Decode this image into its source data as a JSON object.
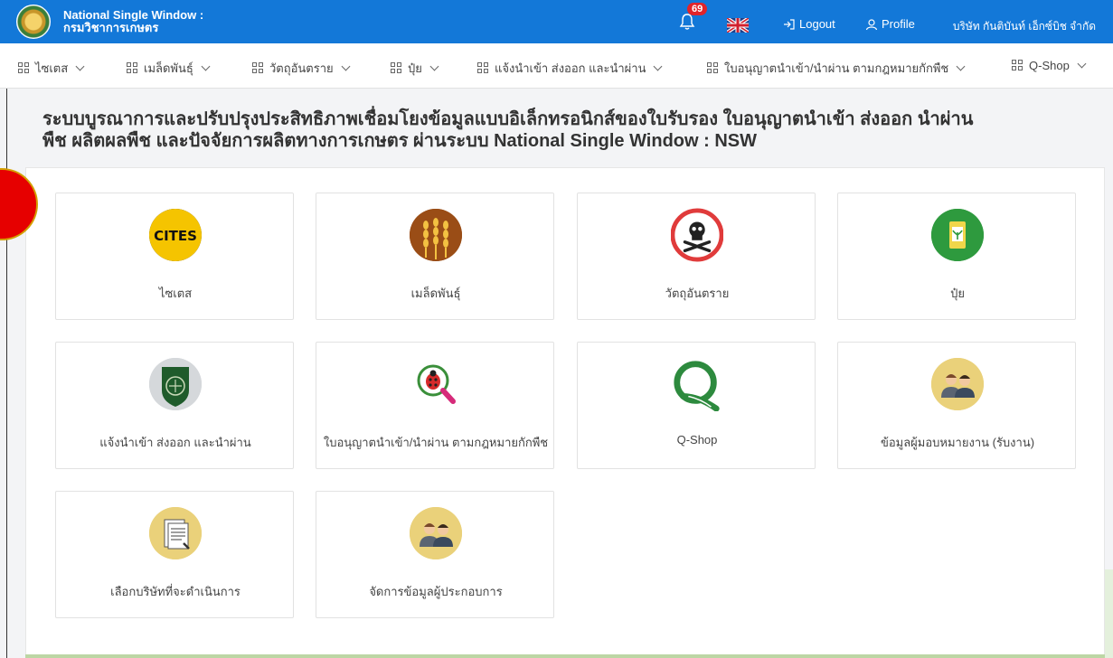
{
  "header": {
    "brand_title": "National Single Window :",
    "brand_subtitle": "กรมวิชาการเกษตร",
    "notification_count": "69",
    "logout_label": "Logout",
    "profile_label": "Profile",
    "company_name": "บริษัท กันติบันท์ เอ็กซ์บิช จำกัด",
    "color": "#1378d8"
  },
  "nav": {
    "items": [
      {
        "label": "ไซเตส"
      },
      {
        "label": "เมล็ดพันธุ์"
      },
      {
        "label": "วัตถุอันตราย"
      },
      {
        "label": "ปุ๋ย"
      },
      {
        "label": "แจ้งนำเข้า ส่งออก และนำผ่าน"
      },
      {
        "label": "ใบอนุญาตนำเข้า/นำผ่าน ตามกฎหมายกักพืช"
      },
      {
        "label": "Q-Shop"
      }
    ]
  },
  "page": {
    "heading_line1": "ระบบบูรณาการและปรับปรุงประสิทธิภาพเชื่อมโยงข้อมูลแบบอิเล็กทรอนิกส์ของใบรับรอง ใบอนุญาตนำเข้า ส่งออก นำผ่าน",
    "heading_line2": "พืช ผลิตผลพืช และปัจจัยการผลิตทางการเกษตร ผ่านระบบ National Single Window : NSW"
  },
  "cards": [
    {
      "label": "ไซเตส",
      "icon": "cites-icon",
      "icon_text": "CITES"
    },
    {
      "label": "เมล็ดพันธุ์",
      "icon": "wheat-icon"
    },
    {
      "label": "วัตถุอันตราย",
      "icon": "skull-icon"
    },
    {
      "label": "ปุ๋ย",
      "icon": "fertilizer-icon"
    },
    {
      "label": "แจ้งนำเข้า ส่งออก และนำผ่าน",
      "icon": "department-seal-icon"
    },
    {
      "label": "ใบอนุญาตนำเข้า/นำผ่าน ตามกฎหมายกักพืช",
      "icon": "ladybug-search-icon"
    },
    {
      "label": "Q-Shop",
      "icon": "q-shop-icon"
    },
    {
      "label": "ข้อมูลผู้มอบหมายงาน (รับงาน)",
      "icon": "users-icon"
    },
    {
      "label": "เลือกบริษัทที่จะดำเนินการ",
      "icon": "document-icon"
    },
    {
      "label": "จัดการข้อมูลผู้ประกอบการ",
      "icon": "users-icon"
    }
  ]
}
